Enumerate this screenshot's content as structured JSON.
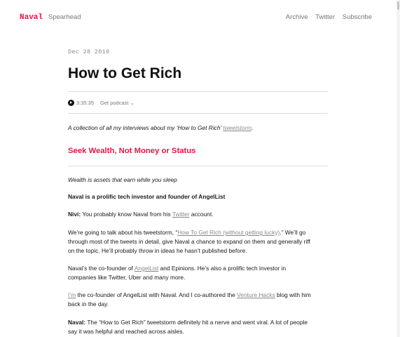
{
  "header": {
    "brand": "Naval",
    "site_name": "Spearhead",
    "nav": [
      "Archive",
      "Twitter",
      "Subscribe"
    ]
  },
  "post": {
    "date": "Dec 28 2019",
    "title": "How to Get Rich",
    "player": {
      "duration": "3:35:35",
      "podcast_label": "Get podcast",
      "chevron": "⌄"
    },
    "intro": {
      "text": "A collection of all my interviews about my ‘How to Get Rich’ ",
      "link": "tweetstorm",
      "end": "."
    },
    "section_heading": "Seek Wealth, Not Money or Status",
    "tagline": "Wealth is assets that earn while you sleep",
    "subheading": "Naval is a prolific tech investor and founder of AngelList",
    "p1": {
      "speaker": "Nivi:",
      "text": " You probably know Naval from his ",
      "link": "Twitter",
      "end": " account."
    },
    "p2": {
      "line1_pre": "We’re going to talk about his tweetstorm, “",
      "line1_link": "How To Get Rich (without getting lucky)",
      "line1_post": ".” We’ll go",
      "line2": "through most of the tweets in detail, give Naval a chance to expand on them and generally riff",
      "line3": "on the topic. He’ll probably throw in ideas he hasn’t published before."
    },
    "p3": {
      "line1_pre": "Naval’s the co-founder of ",
      "line1_link": "AngelList",
      "line1_post": " and Epinions. He’s also a prolific tech investor in",
      "line2": "companies like Twitter, Uber and many more."
    },
    "p4": {
      "line1_link1": "I’m",
      "line1_mid": " the co-founder of AngelList with Naval. And I co-authored the ",
      "line1_link2": "Venture Hacks",
      "line1_post": " blog with him",
      "line2": "back in the day."
    },
    "p5": {
      "speaker": "Naval:",
      "line1": " The “How to Get Rich” tweetstorm definitely hit a nerve and went viral. A lot of people",
      "line2": "say it was helpful and reached across aisles."
    }
  },
  "colors": {
    "accent": "#e0174a",
    "text": "#1a1a1a",
    "muted": "#777777",
    "rule": "#dcdcdc"
  },
  "icons": {
    "play": "play-icon",
    "chevron": "chevron-down-icon"
  }
}
